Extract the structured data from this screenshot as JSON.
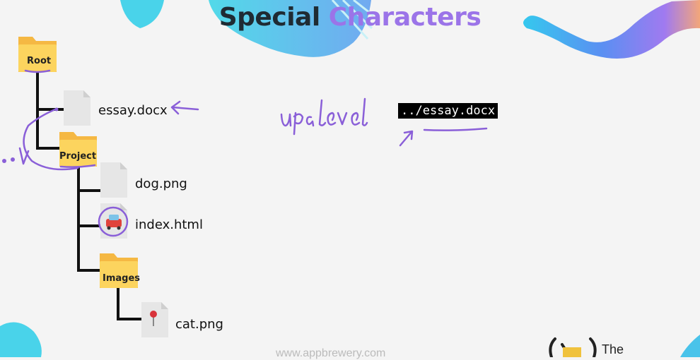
{
  "slide": {
    "title_part1": "Special",
    "title_part2": "Characters",
    "footer_url": "www.appbrewery.com",
    "brand_text": "The"
  },
  "tree": {
    "root_label": "Root",
    "essay_label": "essay.docx",
    "project_label": "Project",
    "dog_label": "dog.png",
    "index_label": "index.html",
    "images_label": "Images",
    "cat_label": "cat.png"
  },
  "annotation": {
    "path_text": "../essay.docx",
    "handwriting": "up a level",
    "dots": ".."
  },
  "colors": {
    "accent": "#9b74e8",
    "dark": "#1f2b33",
    "folder": "#f9c74f",
    "ink": "#8a5fd8"
  }
}
